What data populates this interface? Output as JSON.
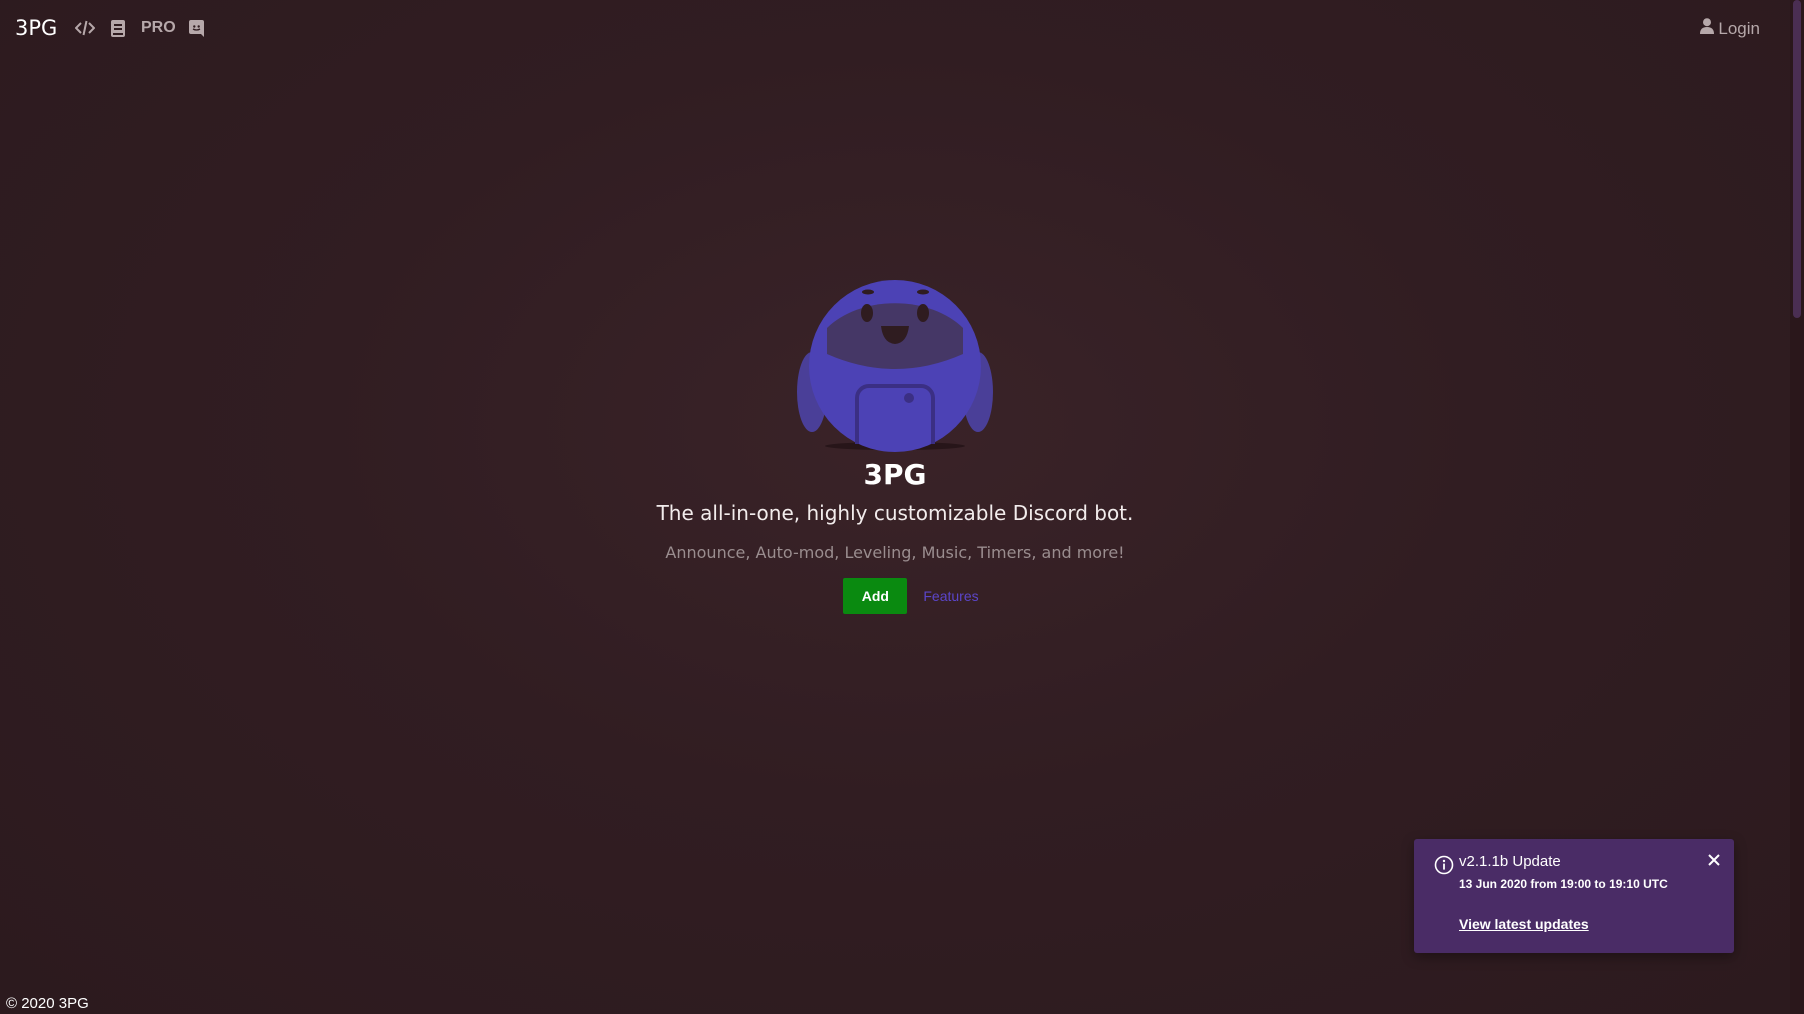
{
  "navbar": {
    "brand": "3PG",
    "icons": [
      "code-icon",
      "book-icon",
      "discord-icon"
    ],
    "pro_label": "PRO",
    "login_label": "Login"
  },
  "hero": {
    "title": "3PG",
    "subtitle": "The all-in-one, highly customizable Discord bot.",
    "features_text": "Announce, Auto-mod, Leveling, Music, Timers, and more!",
    "add_button": "Add",
    "features_link": "Features"
  },
  "footer": {
    "copyright": "© 2020 3PG"
  },
  "toast": {
    "icon": "info-icon",
    "title": "v2.1.1b Update",
    "time": "13 Jun 2020 from 19:00 to 19:10 UTC",
    "link": "View latest updates"
  },
  "colors": {
    "background": "#2f1c20",
    "accent": "#5b45c9",
    "add_button": "#0a8a10",
    "toast_background": "#4a2c66"
  }
}
